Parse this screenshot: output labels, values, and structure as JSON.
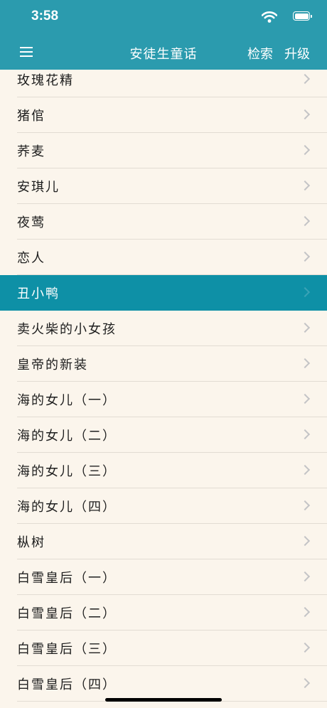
{
  "status_bar": {
    "time": "3:58"
  },
  "nav": {
    "title": "安徒生童话",
    "search_label": "检索",
    "upgrade_label": "升级"
  },
  "colors": {
    "accent": "#2b9bae",
    "selected": "#0e90a6",
    "background": "#fbf5ec"
  },
  "stories": [
    {
      "title": "玫瑰花精",
      "selected": false
    },
    {
      "title": "猪倌",
      "selected": false
    },
    {
      "title": "荞麦",
      "selected": false
    },
    {
      "title": "安琪儿",
      "selected": false
    },
    {
      "title": "夜莺",
      "selected": false
    },
    {
      "title": "恋人",
      "selected": false
    },
    {
      "title": "丑小鸭",
      "selected": true
    },
    {
      "title": "卖火柴的小女孩",
      "selected": false
    },
    {
      "title": "皇帝的新装",
      "selected": false
    },
    {
      "title": "海的女儿（一）",
      "selected": false
    },
    {
      "title": "海的女儿（二）",
      "selected": false
    },
    {
      "title": "海的女儿（三）",
      "selected": false
    },
    {
      "title": "海的女儿（四）",
      "selected": false
    },
    {
      "title": "枞树",
      "selected": false
    },
    {
      "title": "白雪皇后（一）",
      "selected": false
    },
    {
      "title": "白雪皇后（二）",
      "selected": false
    },
    {
      "title": "白雪皇后（三）",
      "selected": false
    },
    {
      "title": "白雪皇后（四）",
      "selected": false
    }
  ]
}
